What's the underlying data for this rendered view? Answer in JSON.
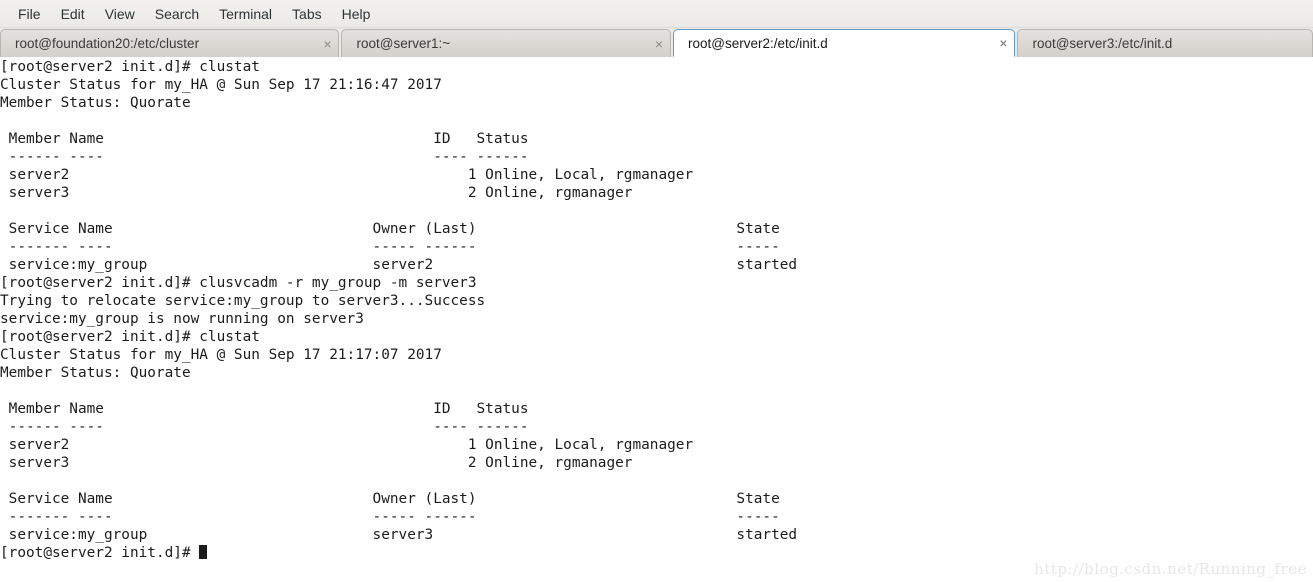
{
  "menubar": {
    "items": [
      {
        "label": "File"
      },
      {
        "label": "Edit"
      },
      {
        "label": "View"
      },
      {
        "label": "Search"
      },
      {
        "label": "Terminal"
      },
      {
        "label": "Tabs"
      },
      {
        "label": "Help"
      }
    ]
  },
  "tabs": [
    {
      "label": "root@foundation20:/etc/cluster",
      "active": false,
      "close": "×"
    },
    {
      "label": "root@server1:~",
      "active": false,
      "close": "×"
    },
    {
      "label": "root@server2:/etc/init.d",
      "active": true,
      "close": "×"
    },
    {
      "label": "root@server3:/etc/init.d",
      "active": false,
      "close": ""
    }
  ],
  "terminal": {
    "prompt": "[root@server2 init.d]# ",
    "lines": [
      "[root@server2 init.d]# clustat",
      "Cluster Status for my_HA @ Sun Sep 17 21:16:47 2017",
      "Member Status: Quorate",
      "",
      " Member Name                                      ID   Status",
      " ------ ----                                      ---- ------",
      " server2                                              1 Online, Local, rgmanager",
      " server3                                              2 Online, rgmanager",
      "",
      " Service Name                              Owner (Last)                              State",
      " ------- ----                              ----- ------                              -----",
      " service:my_group                          server2                                   started",
      "[root@server2 init.d]# clusvcadm -r my_group -m server3",
      "Trying to relocate service:my_group to server3...Success",
      "service:my_group is now running on server3",
      "[root@server2 init.d]# clustat",
      "Cluster Status for my_HA @ Sun Sep 17 21:17:07 2017",
      "Member Status: Quorate",
      "",
      " Member Name                                      ID   Status",
      " ------ ----                                      ---- ------",
      " server2                                              1 Online, Local, rgmanager",
      " server3                                              2 Online, rgmanager",
      "",
      " Service Name                              Owner (Last)                              State",
      " ------- ----                              ----- ------                              -----",
      " service:my_group                          server3                                   started"
    ],
    "last_line": "[root@server2 init.d]# "
  },
  "watermark": {
    "text": "http://blog.csdn.net/Running_free"
  },
  "colors": {
    "terminal_bg": "#ffffff",
    "terminal_fg": "#1c1c1c",
    "chrome_bg": "#ebeae8",
    "active_tab_border": "#5c9ccc",
    "watermark": "#e7e7e7"
  }
}
